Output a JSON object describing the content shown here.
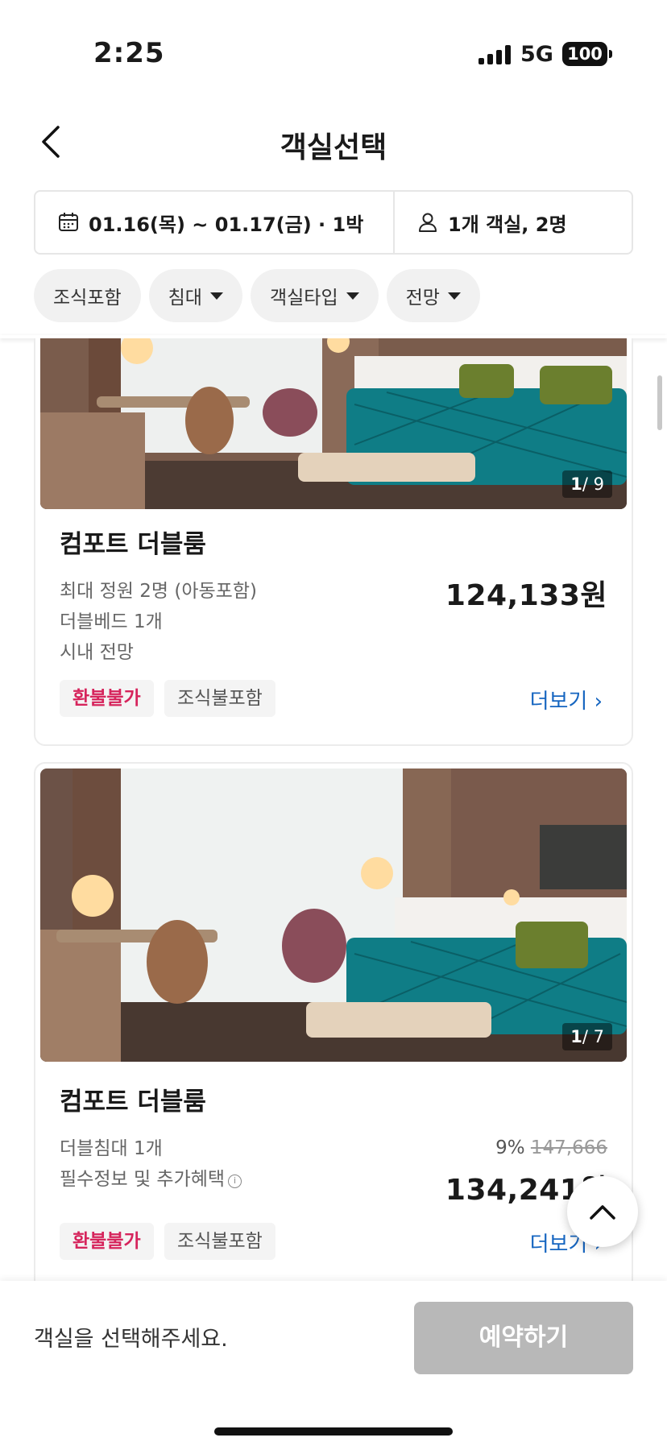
{
  "status_bar": {
    "time": "2:25",
    "network": "5G",
    "battery": "100"
  },
  "header": {
    "title": "객실선택",
    "back_icon": "chevron-left-icon"
  },
  "summary": {
    "dates": "01.16(목) ~ 01.17(금) · 1박",
    "guests": "1개 객실, 2명"
  },
  "filters": [
    {
      "label": "조식포함",
      "dropdown": false
    },
    {
      "label": "침대",
      "dropdown": true
    },
    {
      "label": "객실타입",
      "dropdown": true
    },
    {
      "label": "전망",
      "dropdown": true
    }
  ],
  "rooms": [
    {
      "name": "컴포트 더블룸",
      "photo_current": "1",
      "photo_total": "/ 9",
      "specs": [
        "최대 정원 2명 (아동포함)",
        "더블베드 1개",
        "시내 전망"
      ],
      "price": "124,133원",
      "tags": [
        "환불불가",
        "조식불포함"
      ],
      "more": "더보기"
    },
    {
      "name": "컴포트 더블룸",
      "photo_current": "1",
      "photo_total": "/ 7",
      "specs": [
        "더블침대 1개",
        "필수정보 및 추가혜택"
      ],
      "discount_rate": "9%",
      "original_price": "147,666",
      "price": "134,241원",
      "tags": [
        "환불불가",
        "조식불포함"
      ],
      "more": "더보기"
    }
  ],
  "bottom": {
    "message": "객실을 선택해주세요.",
    "reserve_label": "예약하기"
  },
  "colors": {
    "accent_blue": "#1565c0",
    "refund_red": "#d6245c",
    "disabled_button": "#b8b8b8"
  }
}
